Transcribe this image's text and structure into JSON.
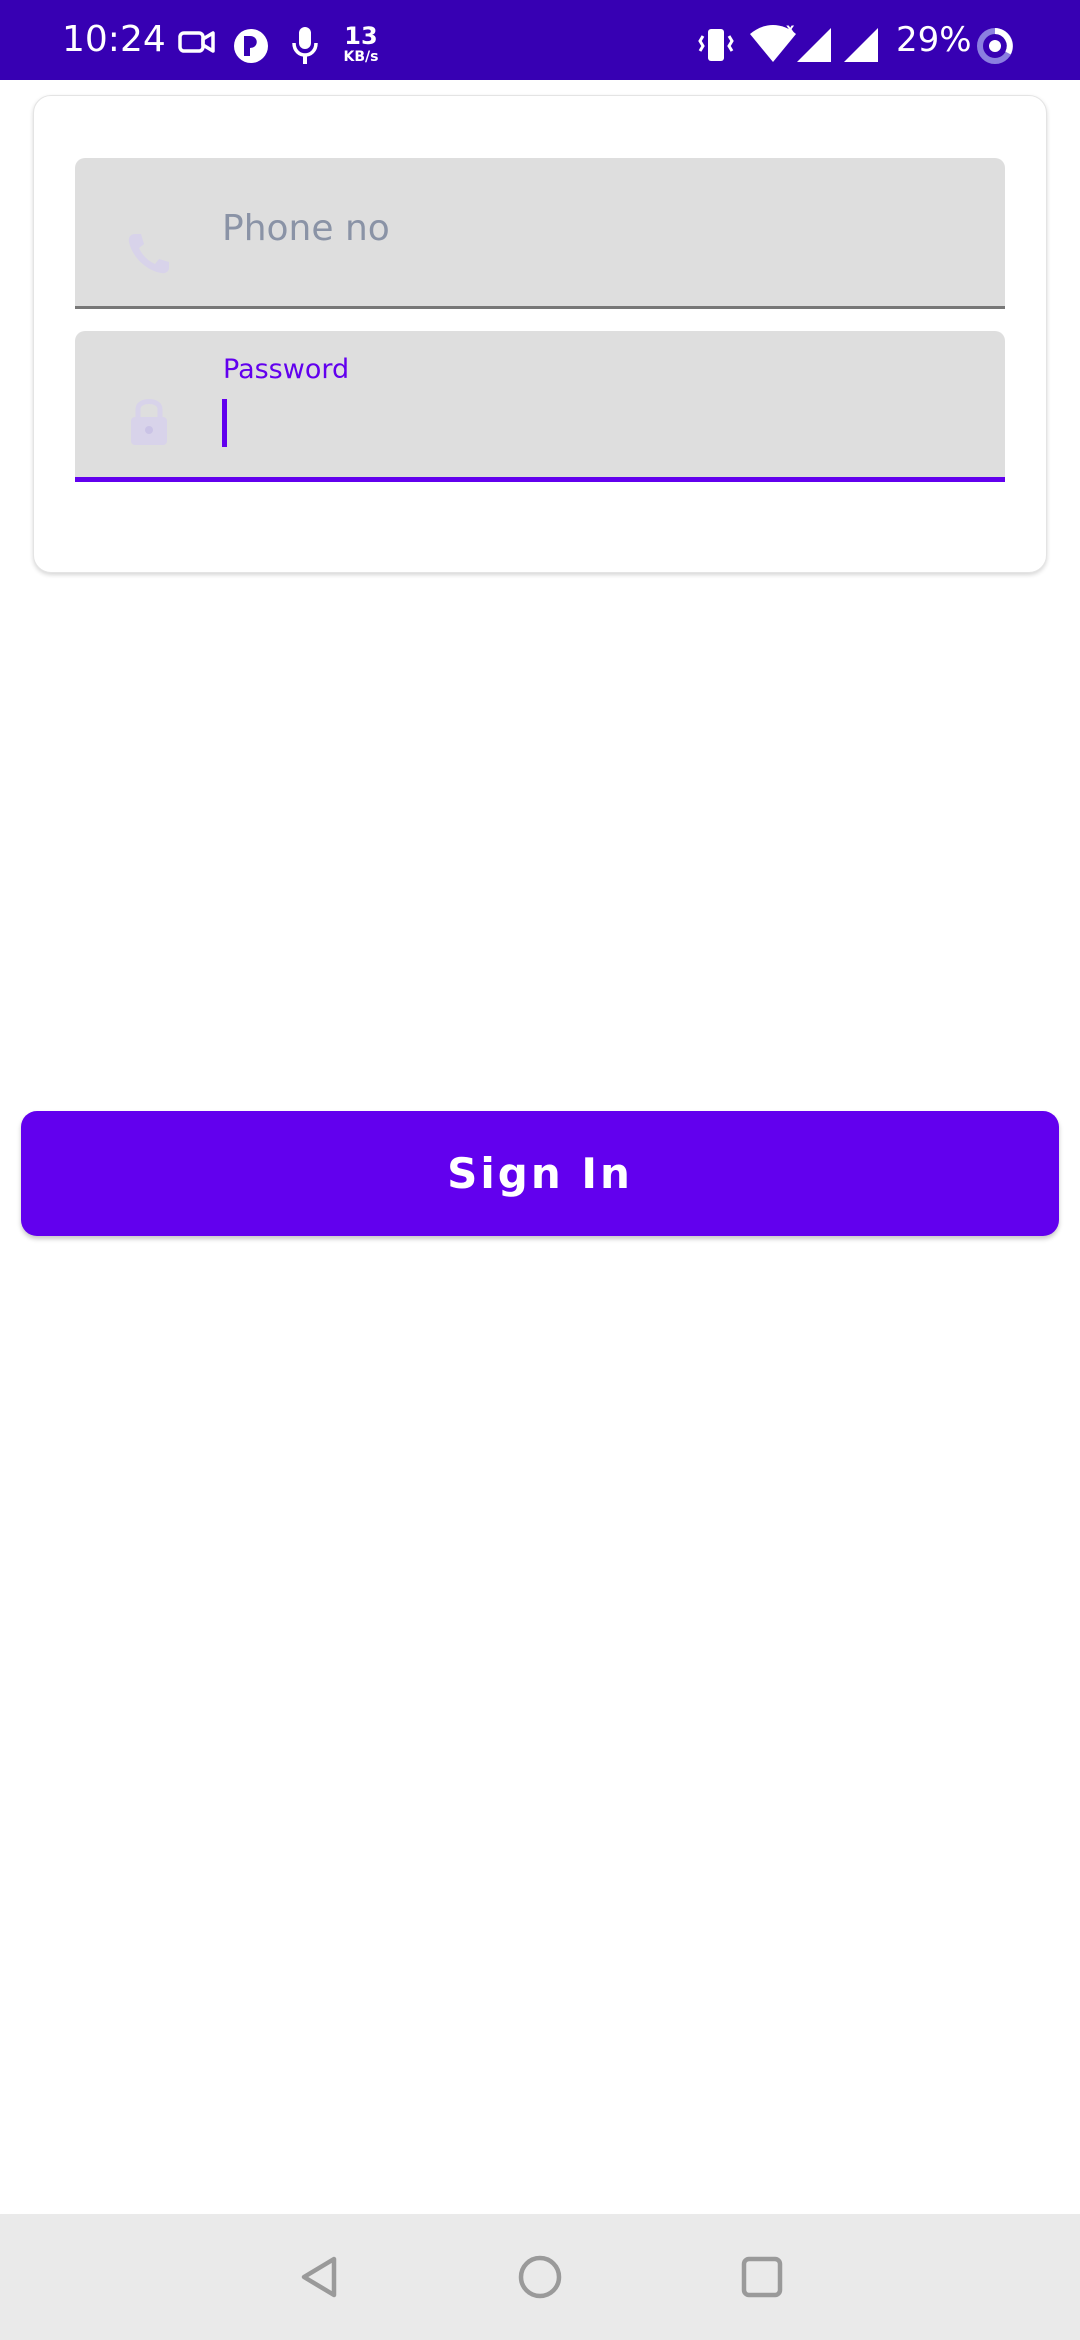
{
  "status_bar": {
    "time": "10:24",
    "net_speed_value": "13",
    "net_speed_unit": "KB/s",
    "battery_percent": "29%",
    "icons": [
      "video-camera-icon",
      "app-notification-icon",
      "microphone-icon",
      "vibrate-icon",
      "wifi-icon",
      "signal-icon",
      "signal-icon",
      "battery-saver-icon"
    ]
  },
  "login_form": {
    "phone_field": {
      "placeholder": "Phone no",
      "value": "",
      "icon": "phone-icon"
    },
    "password_field": {
      "label": "Password",
      "value": "",
      "icon": "lock-icon",
      "focused": true
    },
    "sign_in_label": "Sign In"
  },
  "nav_bar": {
    "buttons": [
      "back-icon",
      "home-icon",
      "recents-icon"
    ]
  },
  "colors": {
    "status_bar": "#3700b3",
    "accent": "#6200ee",
    "field_background": "#dedede",
    "nav_bar": "#eaeaea"
  }
}
